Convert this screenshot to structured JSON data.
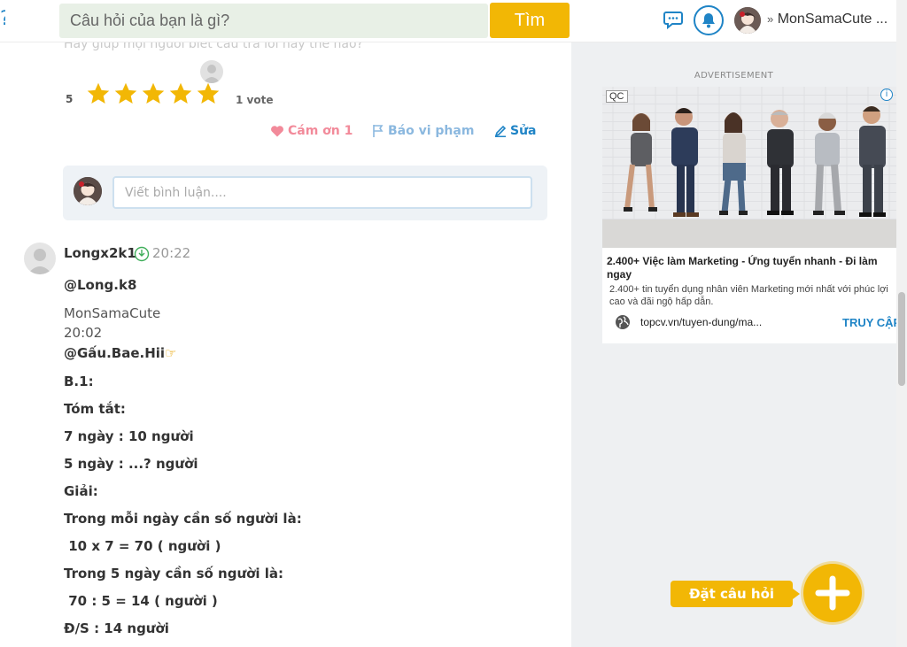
{
  "header": {
    "search_placeholder": "Câu hỏi của bạn là gì?",
    "search_button": "Tìm",
    "user_name": "MonSamaCute ..."
  },
  "question": {
    "faded_text": "Hãy giúp mọi người biết câu trả lời này thế nào?",
    "rating_value": "5",
    "stars": 5,
    "vote_text": "1 vote",
    "thank_label": "Cám ơn 1",
    "report_label": "Báo vi phạm",
    "edit_label": "Sửa",
    "comment_placeholder": "Viết bình luận...."
  },
  "answer": {
    "username": "Longx2k1",
    "time": "20:22",
    "lines": [
      "@Long.k8",
      "MonSamaCute",
      "20:02",
      "@Gấu.Bae.Hii",
      "B.1:",
      "Tóm tắt:",
      "7 ngày : 10 người",
      "5 ngày : ...? người",
      "Giải:",
      "Trong mỗi ngày cần số người là:",
      " 10 x 7 = 70 ( người )",
      "Trong 5 ngày cần số người là:",
      " 70 : 5 = 14 ( người )",
      "Đ/S : 14 người"
    ]
  },
  "ad": {
    "label": "ADVERTISEMENT",
    "badge": "QC",
    "info": "i",
    "title": "2.400+ Việc làm Marketing - Ứng tuyển nhanh - Đi làm ngay",
    "description": "2.400+ tin tuyển dụng nhân viên Marketing mới nhất với phúc lợi cao và đãi ngộ hấp dẫn.",
    "url": "topcv.vn/tuyen-dung/ma...",
    "cta": "TRUY CẬP"
  },
  "ask": {
    "label": "Đặt câu hỏi"
  },
  "colors": {
    "accent": "#f2b705",
    "brand_blue": "#1f84c6",
    "thank_pink": "#f28a9a"
  }
}
